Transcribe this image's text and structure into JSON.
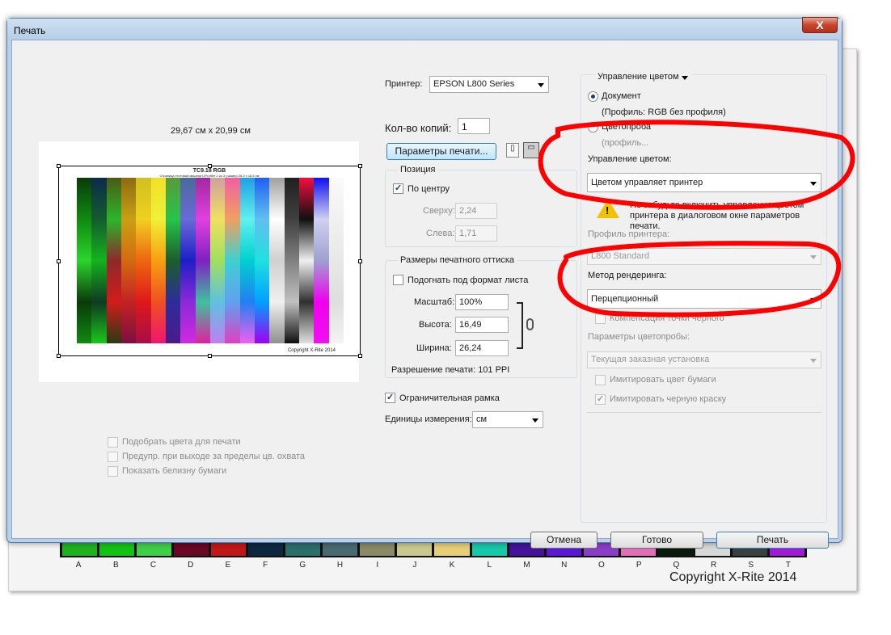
{
  "window": {
    "title": "Печать",
    "close_label": "X"
  },
  "preview": {
    "size_label": "29,67 см x 20,99 см",
    "chart_title": "TC9.18 RGB",
    "chart_subtitle": "Страница тестовой мишени i1Profiler 1 из 3; размер 26.3 x 16.5 см",
    "chart_copyright": "Copyright X-Rite 2014"
  },
  "left_options": [
    {
      "label": "Подобрать цвета для печати",
      "checked": false
    },
    {
      "label": "Предупр. при выходе за пределы цв. охвата",
      "checked": false
    },
    {
      "label": "Показать белизну бумаги",
      "checked": false
    }
  ],
  "printer": {
    "label": "Принтер:",
    "value": "EPSON L800 Series"
  },
  "copies": {
    "label": "Кол-во копий:",
    "value": "1"
  },
  "print_settings_button": "Параметры печати...",
  "position": {
    "title": "Позиция",
    "center_label": "По центру",
    "center_checked": true,
    "top_label": "Сверху:",
    "top_value": "2,24",
    "left_label": "Слева:",
    "left_value": "1,71"
  },
  "print_size": {
    "title": "Размеры печатного оттиска",
    "fit_label": "Подогнать под формат листа",
    "scale_label": "Масштаб:",
    "scale_value": "100%",
    "height_label": "Высота:",
    "height_value": "16,49",
    "width_label": "Ширина:",
    "width_value": "26,24",
    "resolution": "Разрешение печати: 101 PPI"
  },
  "bounding_box": {
    "label": "Ограничительная рамка",
    "checked": true
  },
  "units": {
    "label": "Единицы измерения:",
    "value": "см"
  },
  "color_mgmt": {
    "section_dropdown": "Управление цветом",
    "document_label": "Документ",
    "document_profile": "(Профиль: RGB без профиля)",
    "proof_label": "Цветопроба",
    "proof_partial": "(профиль...",
    "color_handling_label": "Управление цветом:",
    "color_handling_value": "Цветом управляет принтер",
    "warning_text": "Не забудьте включить управление цветом принтера в диалоговом окне параметров печати.",
    "printer_profile_label": "Профиль принтера:",
    "printer_profile_value": "L800 Standard",
    "rendering_label": "Метод рендеринга:",
    "rendering_value": "Перцепционный",
    "bpc_label": "Компенсация точки черного",
    "proof_setup_label": "Параметры цветопробы:",
    "proof_setup_value": "Текущая заказная установка",
    "paper_color_label": "Имитировать цвет бумаги",
    "black_ink_label": "Имитировать черную краску"
  },
  "buttons": {
    "cancel": "Отмена",
    "done": "Готово",
    "print": "Печать"
  },
  "background": {
    "labels": [
      "A",
      "B",
      "C",
      "D",
      "E",
      "F",
      "G",
      "H",
      "I",
      "J",
      "K",
      "L",
      "M",
      "N",
      "O",
      "P",
      "Q",
      "R",
      "S",
      "T"
    ],
    "copyright": "Copyright X-Rite 2014"
  },
  "colors": {
    "annotation": "#ff0000",
    "accent": "#1d3e76"
  }
}
